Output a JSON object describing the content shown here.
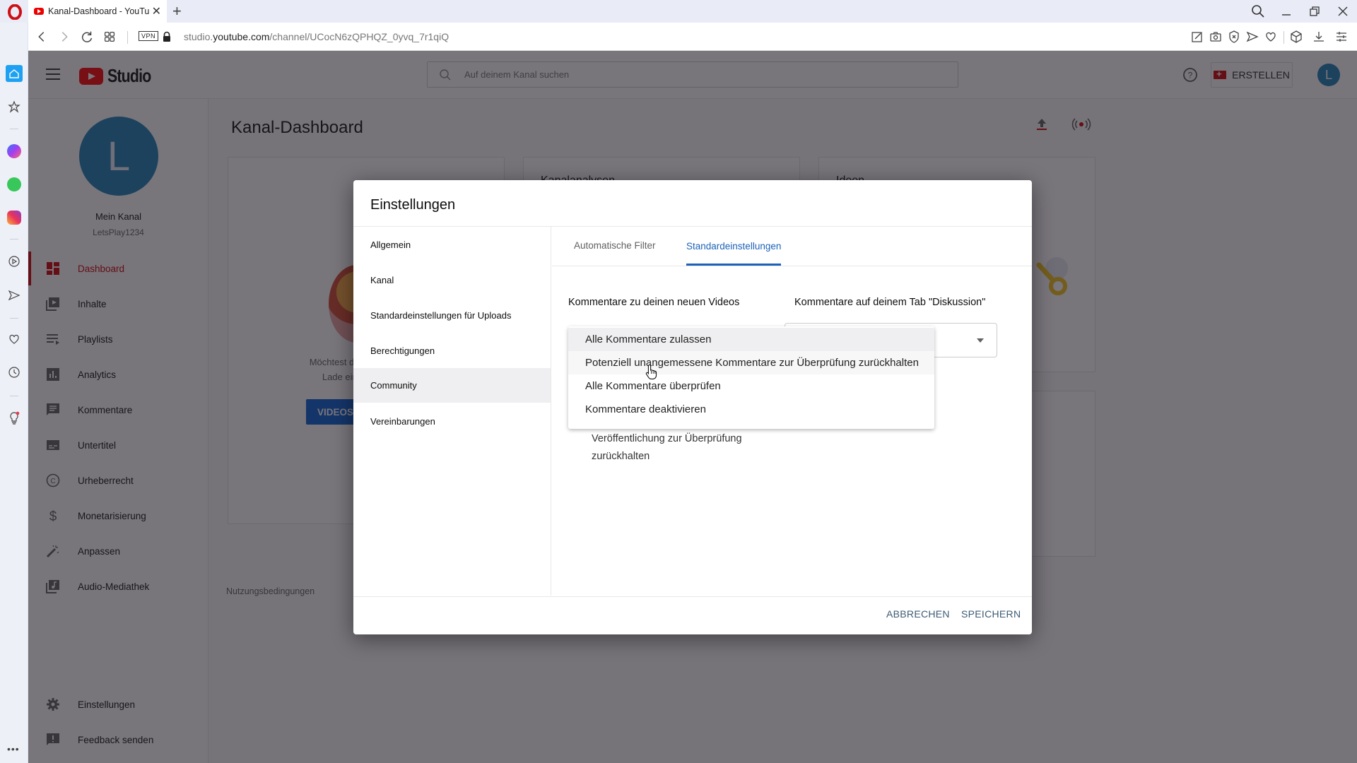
{
  "browser": {
    "tab_title": "Kanal-Dashboard - YouTub",
    "url_prefix": "studio.",
    "url_domain": "youtube.com",
    "url_path": "/channel/UCocN6zQPHQZ_0yvq_7r1qiQ",
    "vpn_label": "VPN",
    "new_tab_label": "+",
    "close_tab_label": "✕"
  },
  "studio": {
    "logo_text": "Studio",
    "search_placeholder": "Auf deinem Kanal suchen",
    "create_label": "ERSTELLEN",
    "account_initial": "L",
    "channel": {
      "initial": "L",
      "name": "Mein Kanal",
      "handle": "LetsPlay1234"
    },
    "nav": [
      {
        "label": "Dashboard",
        "icon": "dashboard-icon",
        "active": true
      },
      {
        "label": "Inhalte",
        "icon": "content-icon"
      },
      {
        "label": "Playlists",
        "icon": "playlists-icon"
      },
      {
        "label": "Analytics",
        "icon": "analytics-icon"
      },
      {
        "label": "Kommentare",
        "icon": "comments-icon"
      },
      {
        "label": "Untertitel",
        "icon": "subtitles-icon"
      },
      {
        "label": "Urheberrecht",
        "icon": "copyright-icon"
      },
      {
        "label": "Monetarisierung",
        "icon": "dollar-icon"
      },
      {
        "label": "Anpassen",
        "icon": "magic-wand-icon"
      },
      {
        "label": "Audio-Mediathek",
        "icon": "audio-library-icon"
      }
    ],
    "nav_bottom": [
      {
        "label": "Einstellungen",
        "icon": "gear-icon"
      },
      {
        "label": "Feedback senden",
        "icon": "feedback-icon"
      }
    ],
    "page_title": "Kanal-Dashboard",
    "card1_text_line1": "Möchtest du Messwerte zu",
    "card1_text_line2": "Lade ein Video hoch",
    "card1_button": "VIDEOS",
    "card2_title": "Kanalanalysen",
    "card3_title": "Ideen",
    "terms_link": "Nutzungsbedingungen"
  },
  "dialog": {
    "title": "Einstellungen",
    "nav": [
      {
        "label": "Allgemein"
      },
      {
        "label": "Kanal"
      },
      {
        "label": "Standardeinstellungen für Uploads"
      },
      {
        "label": "Berechtigungen"
      },
      {
        "label": "Community",
        "selected": true
      },
      {
        "label": "Vereinbarungen"
      }
    ],
    "tabs": [
      {
        "label": "Automatische Filter"
      },
      {
        "label": "Standardeinstellungen",
        "selected": true
      }
    ],
    "col1_heading": "Kommentare zu deinen neuen Videos",
    "col2_heading": "Kommentare auf deinem Tab \"Diskussion\"",
    "hold_text_line1": "Veröffentlichung zur Überprüfung",
    "hold_text_line2": "zurückhalten",
    "cancel_label": "ABBRECHEN",
    "save_label": "SPEICHERN",
    "dropdown_options": [
      {
        "label": "Alle Kommentare zulassen",
        "selected": true
      },
      {
        "label": "Potenziell unangemessene Kommentare zur Überprüfung zurückhalten",
        "hovered": true
      },
      {
        "label": "Alle Kommentare überprüfen"
      },
      {
        "label": "Kommentare deaktivieren"
      }
    ]
  },
  "colors": {
    "accent_blue": "#1c62b9",
    "youtube_red": "#ff0000",
    "avatar_blue": "#1b7fb5"
  }
}
